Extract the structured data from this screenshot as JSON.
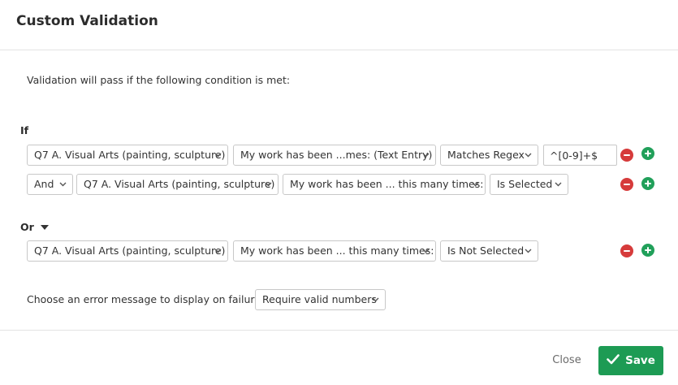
{
  "dialog": {
    "title": "Custom Validation",
    "intro": "Validation will pass if the following condition is met:"
  },
  "if_group": {
    "label": "If",
    "rows": [
      {
        "question": "Q7 A. Visual Arts (painting, sculpture)",
        "field": "My work has been ...mes: (Text Entry)",
        "operator": "Matches Regex",
        "value": "^[0-9]+$"
      },
      {
        "conjunction": "And",
        "question": "Q7 A. Visual Arts (painting, sculpture)",
        "field": "My work has been ... this many times:",
        "operator": "Is Selected"
      }
    ]
  },
  "or_group": {
    "label": "Or",
    "rows": [
      {
        "question": "Q7 A. Visual Arts (painting, sculpture)",
        "field": "My work has been ... this many times:",
        "operator": "Is Not Selected"
      }
    ]
  },
  "error_message": {
    "label": "Choose an error message to display on failure:",
    "selected": "Require valid numbers"
  },
  "footer": {
    "close_label": "Close",
    "save_label": "Save"
  },
  "colors": {
    "accent_green": "#1d9b54",
    "remove_red": "#d63b3b",
    "add_green": "#21a05a"
  }
}
